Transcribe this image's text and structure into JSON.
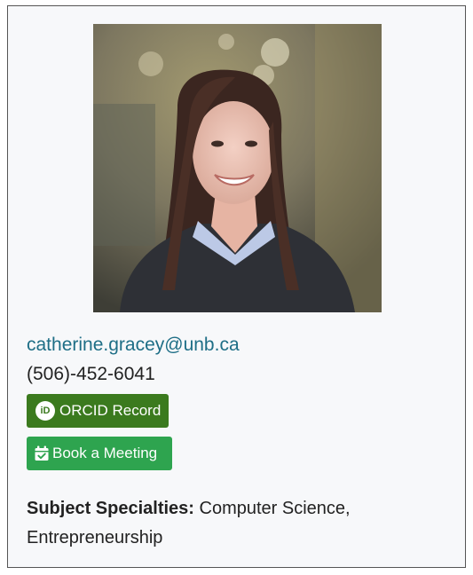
{
  "profile": {
    "photo_alt": "Portrait photo",
    "email": "catherine.gracey@unb.ca",
    "phone": "(506)-452-6041"
  },
  "buttons": {
    "orcid_label": "ORCID Record",
    "orcid_icon": "orcid-icon",
    "orcid_color": "#3b7a1e",
    "book_label": "Book a Meeting",
    "book_icon": "calendar-check-icon",
    "book_color": "#2ea44f"
  },
  "specialties": {
    "label": "Subject Specialties:",
    "line1": "Computer Science,",
    "line2": "Entrepreneurship"
  },
  "colors": {
    "link": "#1e6e86",
    "card_background": "#f7f8fa",
    "card_border": "#555555"
  }
}
